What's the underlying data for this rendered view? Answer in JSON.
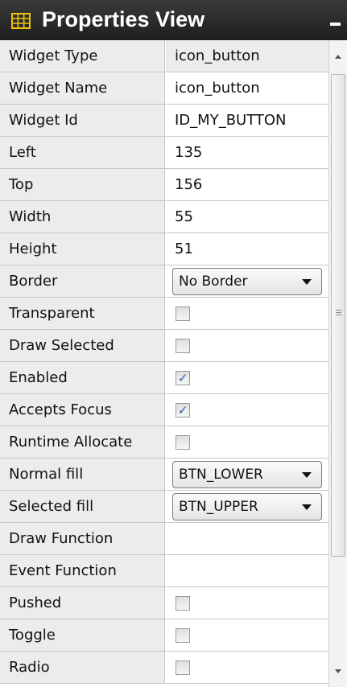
{
  "panel": {
    "title": "Properties View",
    "title_icon": "grid-icon",
    "minimize_icon": "minimize-icon"
  },
  "properties": [
    {
      "label": "Widget Type",
      "value": "icon_button"
    },
    {
      "label": "Widget Name",
      "value": "icon_button"
    },
    {
      "label": "Widget Id",
      "value": "ID_MY_BUTTON"
    },
    {
      "label": "Left",
      "value": "135"
    },
    {
      "label": "Top",
      "value": "156"
    },
    {
      "label": "Width",
      "value": "55"
    },
    {
      "label": "Height",
      "value": "51"
    },
    {
      "label": "Border",
      "value": "No Border",
      "control": "dropdown"
    },
    {
      "label": "Transparent",
      "checked": false,
      "control": "checkbox"
    },
    {
      "label": "Draw Selected",
      "checked": false,
      "control": "checkbox"
    },
    {
      "label": "Enabled",
      "checked": true,
      "control": "checkbox"
    },
    {
      "label": "Accepts Focus",
      "checked": true,
      "control": "checkbox"
    },
    {
      "label": "Runtime Allocate",
      "checked": false,
      "control": "checkbox"
    },
    {
      "label": "Normal fill",
      "value": "BTN_LOWER",
      "control": "dropdown"
    },
    {
      "label": "Selected fill",
      "value": "BTN_UPPER",
      "control": "dropdown"
    },
    {
      "label": "Draw Function",
      "value": ""
    },
    {
      "label": "Event Function",
      "value": ""
    },
    {
      "label": "Pushed",
      "checked": false,
      "control": "checkbox"
    },
    {
      "label": "Toggle",
      "checked": false,
      "control": "checkbox"
    },
    {
      "label": "Radio",
      "checked": false,
      "control": "checkbox"
    }
  ],
  "colors": {
    "titlebar": "#2a2a2a",
    "icon_accent": "#f2c200",
    "check_mark": "#2a5db0"
  }
}
